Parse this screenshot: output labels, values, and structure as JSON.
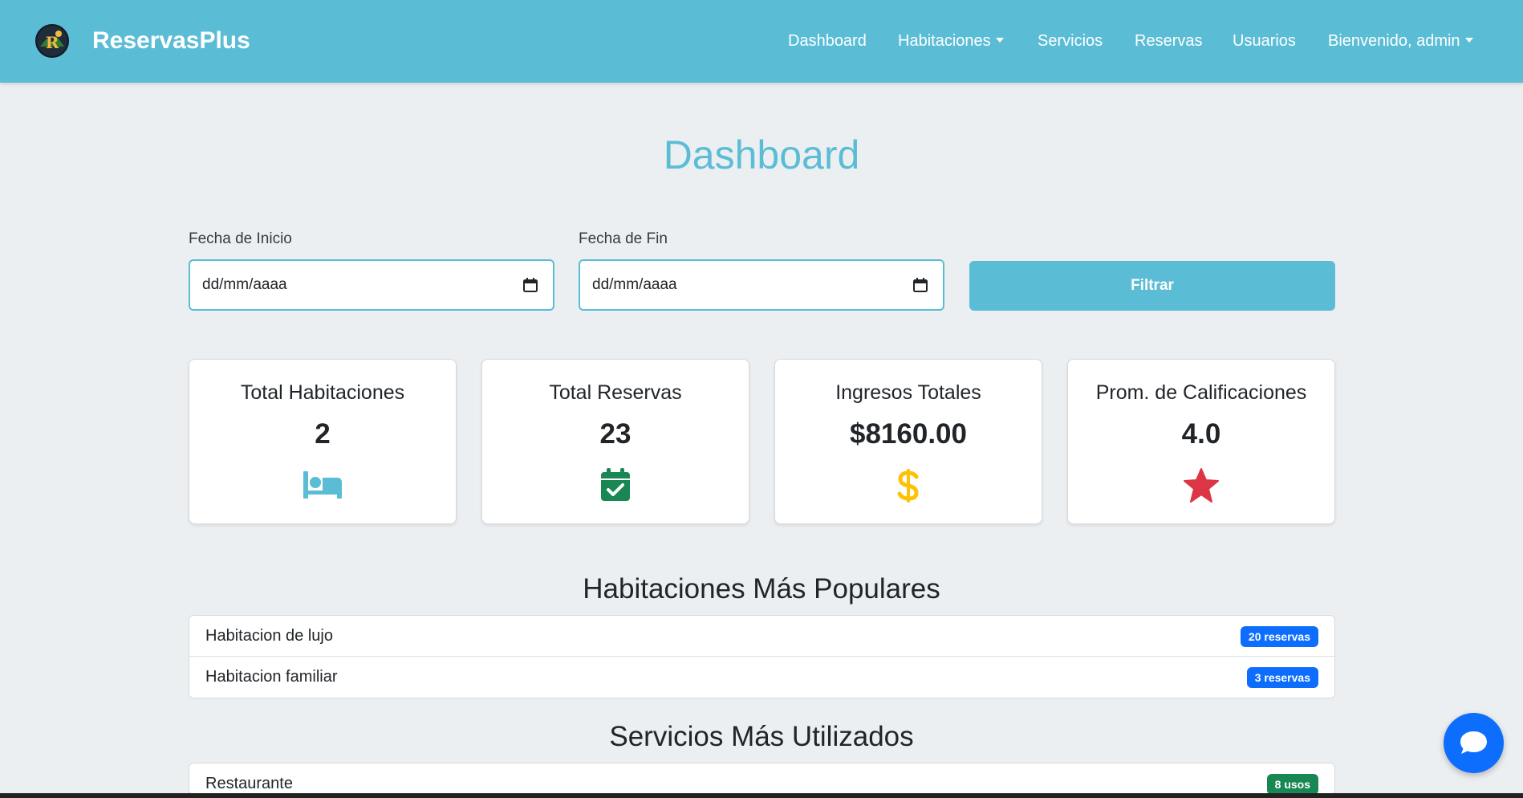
{
  "brand": {
    "name": "ReservasPlus",
    "logo_letter": "R"
  },
  "nav": {
    "dashboard": "Dashboard",
    "habitaciones": "Habitaciones",
    "servicios": "Servicios",
    "reservas": "Reservas",
    "usuarios": "Usuarios",
    "user_menu": "Bienvenido, admin"
  },
  "page": {
    "title": "Dashboard"
  },
  "filter": {
    "start_label": "Fecha de Inicio",
    "start_value": "dd/mm/aaaa",
    "end_label": "Fecha de Fin",
    "end_value": "dd/mm/aaaa",
    "button": "Filtrar"
  },
  "stats": [
    {
      "label": "Total Habitaciones",
      "value": "2",
      "icon": "bed-icon",
      "color": "#5bbdd5"
    },
    {
      "label": "Total Reservas",
      "value": "23",
      "icon": "calendar-check-icon",
      "color": "#198754"
    },
    {
      "label": "Ingresos Totales",
      "value": "$8160.00",
      "icon": "dollar-icon",
      "color": "#ffc107"
    },
    {
      "label": "Prom. de Calificaciones",
      "value": "4.0",
      "icon": "star-icon",
      "color": "#dc3545"
    }
  ],
  "popular_rooms": {
    "title": "Habitaciones Más Populares",
    "items": [
      {
        "name": "Habitacion de lujo",
        "badge": "20 reservas"
      },
      {
        "name": "Habitacion familiar",
        "badge": "3 reservas"
      }
    ]
  },
  "top_services": {
    "title": "Servicios Más Utilizados",
    "items": [
      {
        "name": "Restaurante",
        "badge": "8 usos"
      }
    ]
  },
  "colors": {
    "primary": "#5bbdd5",
    "badge_blue": "#0d6efd",
    "badge_green": "#198754",
    "background": "#eceff1"
  },
  "chat": {
    "icon": "chat-bubble-icon"
  }
}
